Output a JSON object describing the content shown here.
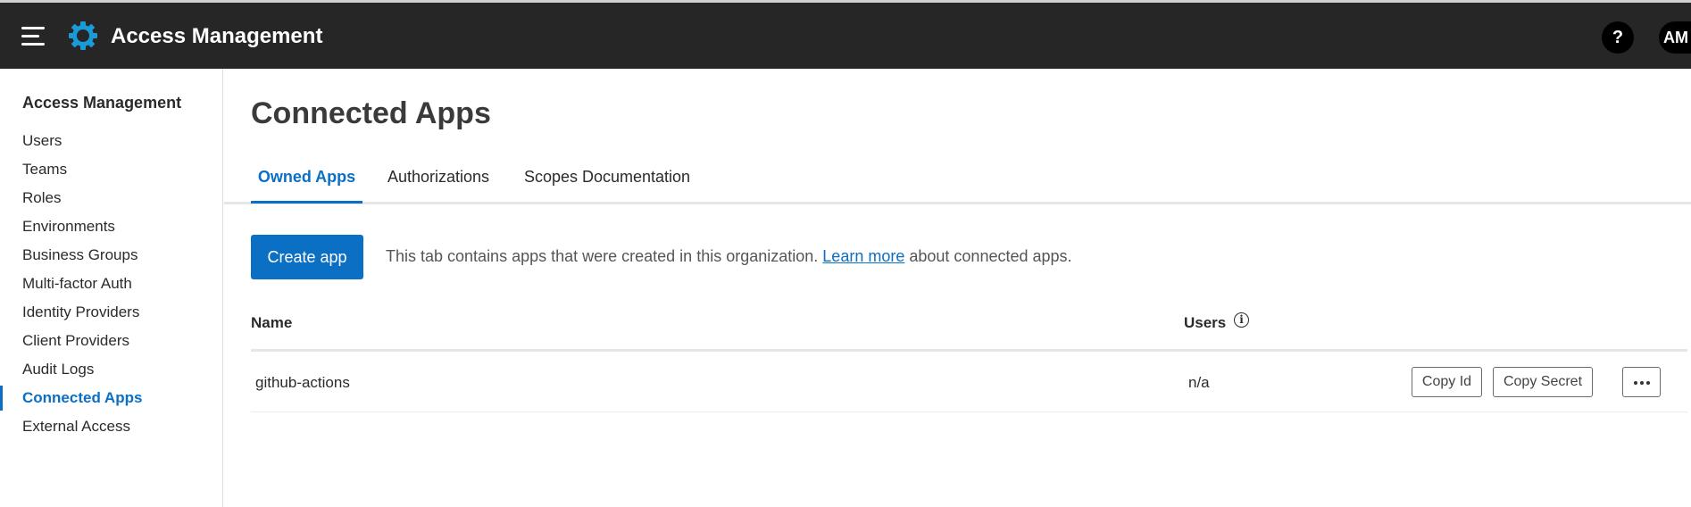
{
  "header": {
    "app_title": "Access Management",
    "help_label": "?",
    "avatar_initials": "AM",
    "accent_color": "#0b6fc4"
  },
  "sidebar": {
    "heading": "Access Management",
    "items": [
      {
        "label": "Users",
        "active": false
      },
      {
        "label": "Teams",
        "active": false
      },
      {
        "label": "Roles",
        "active": false
      },
      {
        "label": "Environments",
        "active": false
      },
      {
        "label": "Business Groups",
        "active": false
      },
      {
        "label": "Multi-factor Auth",
        "active": false
      },
      {
        "label": "Identity Providers",
        "active": false
      },
      {
        "label": "Client Providers",
        "active": false
      },
      {
        "label": "Audit Logs",
        "active": false
      },
      {
        "label": "Connected Apps",
        "active": true
      },
      {
        "label": "External Access",
        "active": false
      }
    ]
  },
  "main": {
    "title": "Connected Apps",
    "tabs": [
      {
        "label": "Owned Apps",
        "active": true
      },
      {
        "label": "Authorizations",
        "active": false
      },
      {
        "label": "Scopes Documentation",
        "active": false
      }
    ],
    "create_button": "Create app",
    "info_prefix": "This tab contains apps that were created in this organization.",
    "info_link": "Learn more",
    "info_suffix": "about connected apps.",
    "table": {
      "columns": [
        "Name",
        "Users"
      ],
      "users_info_icon": "i",
      "rows": [
        {
          "name": "github-actions",
          "users": "n/a",
          "copy_id": "Copy Id",
          "copy_secret": "Copy Secret"
        }
      ]
    }
  }
}
